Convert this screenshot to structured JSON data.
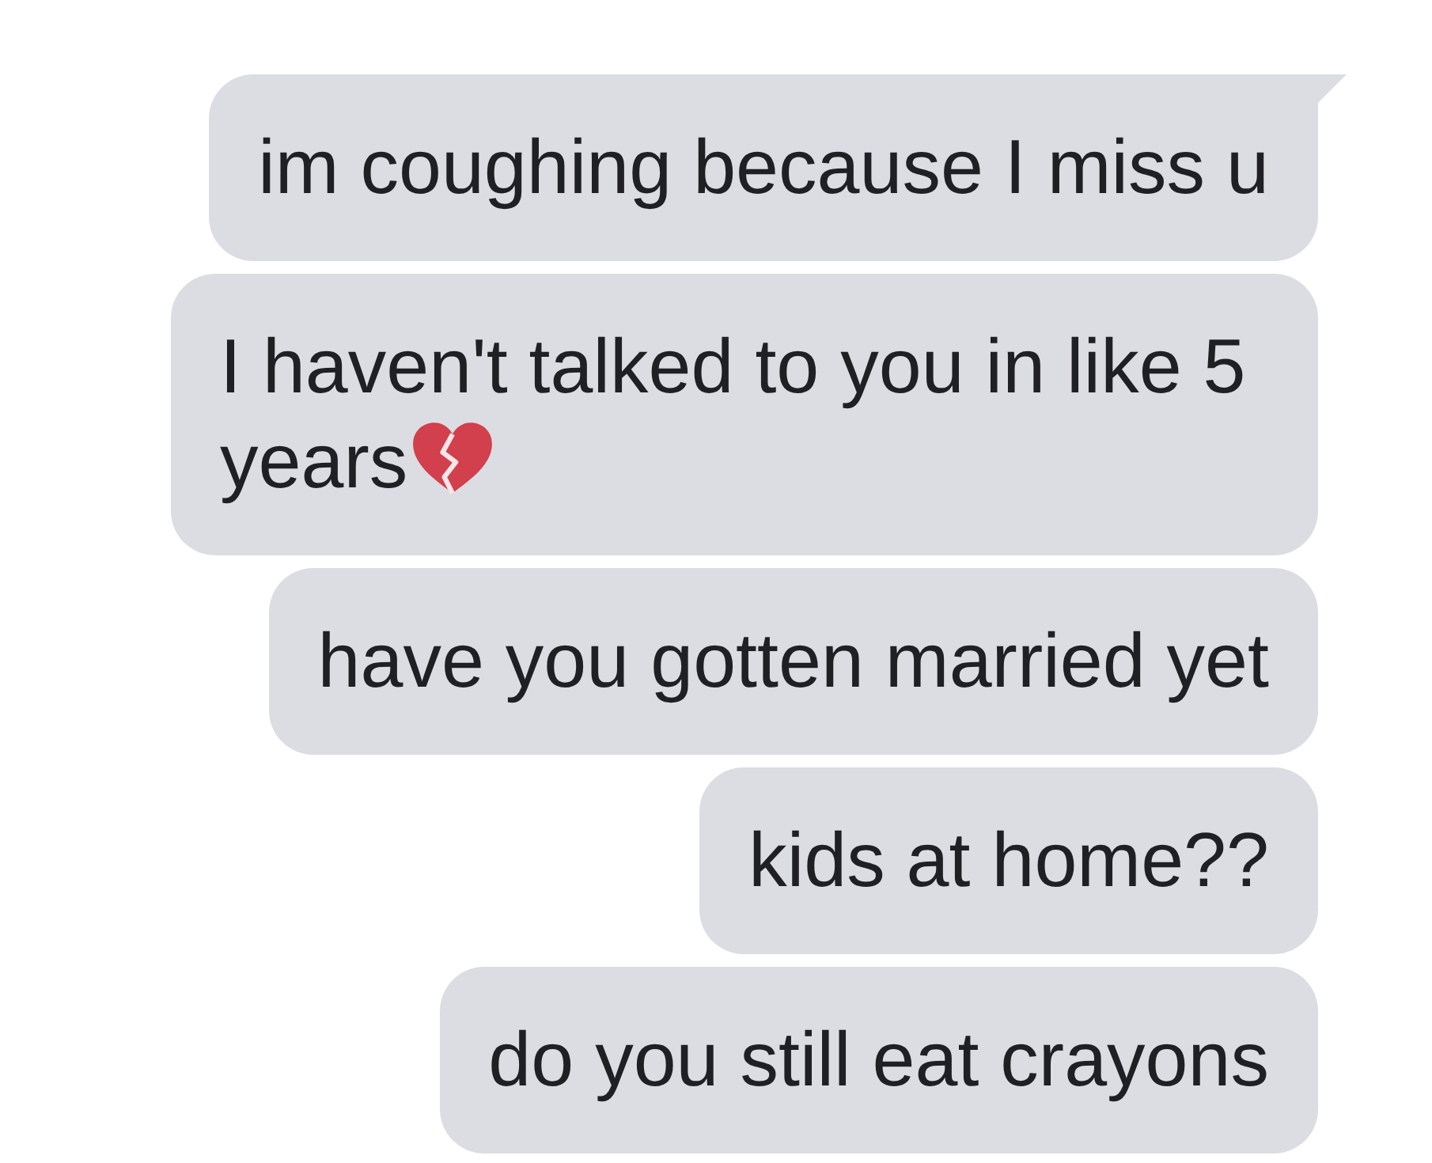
{
  "messages": [
    {
      "text": "im coughing because I miss u",
      "tail": true,
      "emoji": false
    },
    {
      "text": "I haven't talked to you in like 5 years",
      "tail": false,
      "emoji": true
    },
    {
      "text": "have you gotten married yet",
      "tail": false,
      "emoji": false
    },
    {
      "text": "kids at home??",
      "tail": false,
      "emoji": false
    },
    {
      "text": "do you still eat crayons",
      "tail": false,
      "emoji": false
    }
  ]
}
